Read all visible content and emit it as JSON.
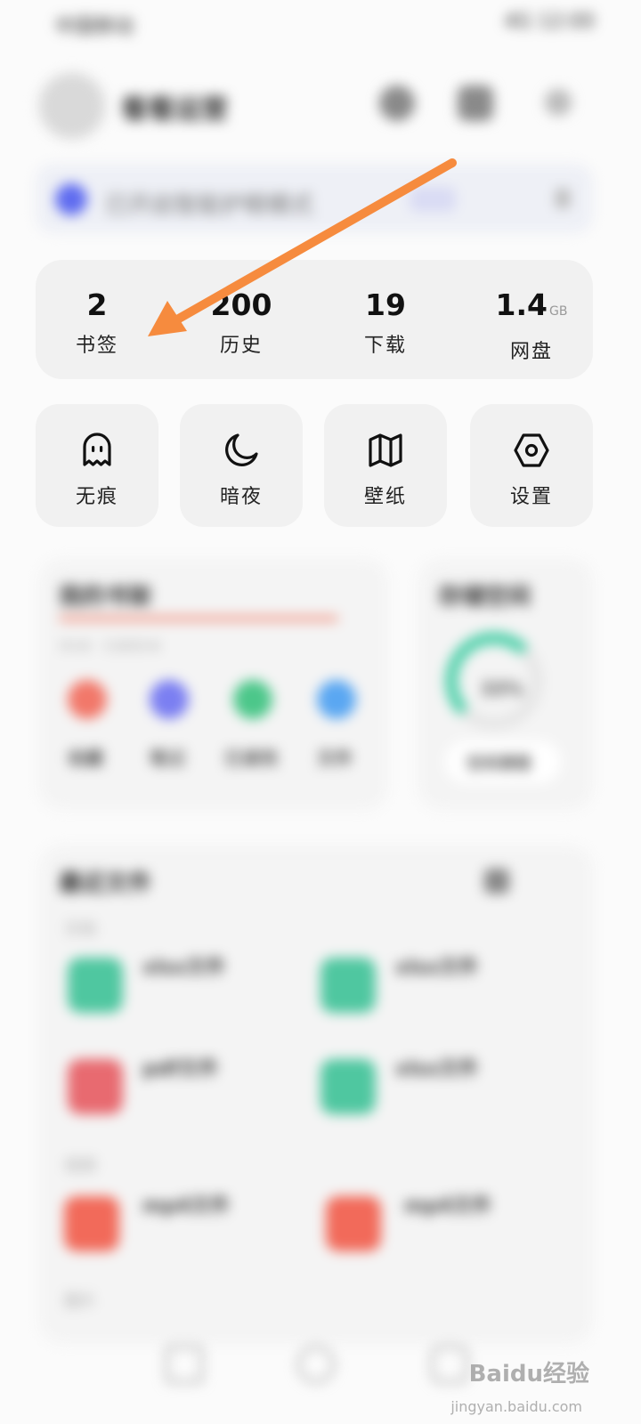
{
  "status_bar": {
    "left": "中国移动",
    "right": "4G 12:00"
  },
  "profile": {
    "username": "看看运营"
  },
  "banner": {
    "text": "已开启智能护眼模式"
  },
  "stats": [
    {
      "value": "2",
      "unit": "",
      "label": "书签"
    },
    {
      "value": "200",
      "unit": "",
      "label": "历史"
    },
    {
      "value": "19",
      "unit": "",
      "label": "下载"
    },
    {
      "value": "1.4",
      "unit": "GB",
      "label": "网盘"
    }
  ],
  "tiles": [
    {
      "label": "无痕",
      "icon": "ghost-icon"
    },
    {
      "label": "暗夜",
      "icon": "moon-icon"
    },
    {
      "label": "壁纸",
      "icon": "map-icon"
    },
    {
      "label": "设置",
      "icon": "hexagon-settings-icon"
    }
  ],
  "tools_card": {
    "title": "我的书架",
    "subtitle": "共5本 · 已读完5本",
    "items": [
      {
        "label": "收藏",
        "color": "#f2786a"
      },
      {
        "label": "笔记",
        "color": "#7b7ff2"
      },
      {
        "label": "已读完",
        "color": "#4cc78a"
      },
      {
        "label": "文件",
        "color": "#5aa7f2"
      }
    ]
  },
  "space_card": {
    "title": "存储空间",
    "value": "33%",
    "button": "空间清理"
  },
  "recent_card": {
    "title": "最近文件",
    "sections": [
      "文档",
      "视频",
      "图片"
    ],
    "files": [
      {
        "name": "xlsx文件",
        "color": "#4fc7a0"
      },
      {
        "name": "xlsx文件",
        "color": "#4fc7a0"
      },
      {
        "name": "pdf文件",
        "color": "#e86a70"
      },
      {
        "name": "xlsx文件",
        "color": "#4fc7a0"
      },
      {
        "name": "mp4文件",
        "color": "#f26a5a"
      },
      {
        "name": "mp4文件",
        "color": "#f26a5a"
      }
    ]
  },
  "watermark": {
    "text": "Baidu经验",
    "sub": "jingyan.baidu.com"
  },
  "colors": {
    "arrow": "#f68b3e",
    "card_bg": "#f1f1f1"
  }
}
